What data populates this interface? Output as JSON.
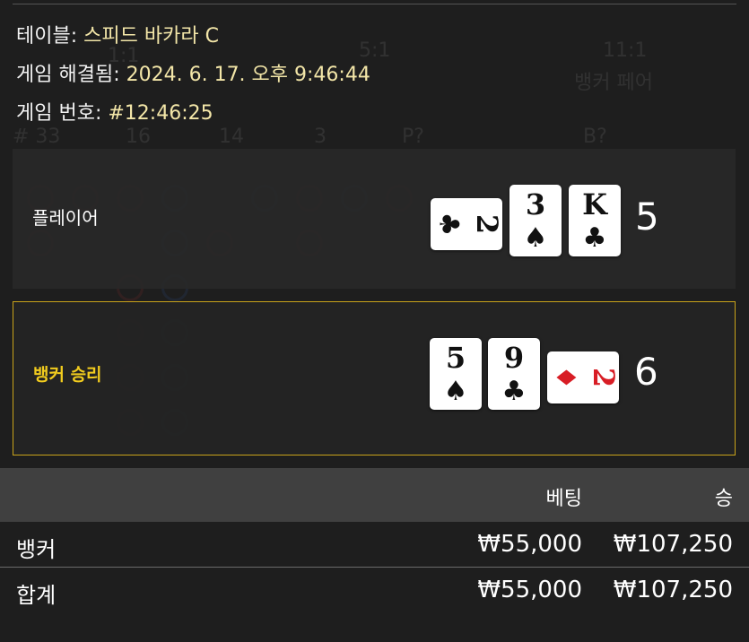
{
  "info": {
    "table_label": "테이블: ",
    "table_value": "스피드 바카라 C",
    "resolved_label": "게임 해결됨: ",
    "resolved_value": "2024. 6. 17. 오후 9:46:44",
    "round_label": "게임 번호: ",
    "round_value": "#12:46:25"
  },
  "player_hand": {
    "label": "플레이어",
    "score": "5",
    "cards": [
      {
        "rank": "2",
        "suit": "♣",
        "color": "#111111",
        "orientation": "sideways"
      },
      {
        "rank": "3",
        "suit": "♠",
        "color": "#111111",
        "orientation": "upright"
      },
      {
        "rank": "K",
        "suit": "♣",
        "color": "#111111",
        "orientation": "upright"
      }
    ]
  },
  "banker_hand": {
    "label": "뱅커 승리",
    "score": "6",
    "highlight_color": "#f2cc1e",
    "cards": [
      {
        "rank": "5",
        "suit": "♠",
        "color": "#111111",
        "orientation": "upright"
      },
      {
        "rank": "9",
        "suit": "♣",
        "color": "#111111",
        "orientation": "upright"
      },
      {
        "rank": "2",
        "suit": "♦",
        "color": "#d81d25",
        "orientation": "sideways"
      }
    ]
  },
  "bets": {
    "col_bet": "베팅",
    "col_win": "승",
    "rows": [
      {
        "label": "뱅커",
        "bet": "₩55,000",
        "win": "₩107,250"
      },
      {
        "label": "합계",
        "bet": "₩55,000",
        "win": "₩107,250"
      }
    ]
  }
}
